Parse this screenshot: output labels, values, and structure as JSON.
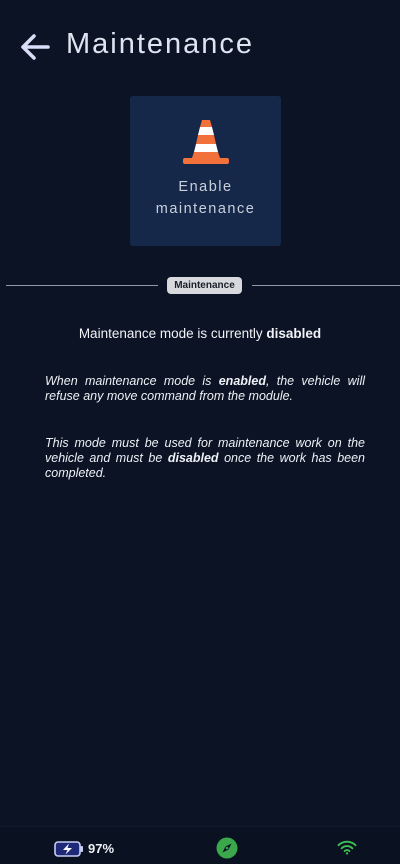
{
  "header": {
    "title": "Maintenance",
    "back_icon": "arrow-left-icon"
  },
  "enable_card": {
    "icon": "traffic-cone-icon",
    "label_line1": "Enable",
    "label_line2": "maintenance"
  },
  "section": {
    "badge": "Maintenance"
  },
  "status": {
    "prefix": "Maintenance mode is currently ",
    "value": "disabled"
  },
  "info": {
    "p1_a": "When maintenance mode is ",
    "p1_b": "enabled",
    "p1_c": ", the vehicle will refuse any move command from the module.",
    "p2_a": "This mode must be used for maintenance work on the vehicle and must be ",
    "p2_b": "disabled",
    "p2_c": " once the work has been completed."
  },
  "bottom_bar": {
    "battery_icon": "battery-charging-icon",
    "battery_percent": "97%",
    "compass_icon": "compass-icon",
    "wifi_icon": "wifi-icon"
  },
  "colors": {
    "background": "#0b1324",
    "card": "#16284a",
    "cone_orange": "#f2703a",
    "accent_green": "#3aa84b"
  }
}
